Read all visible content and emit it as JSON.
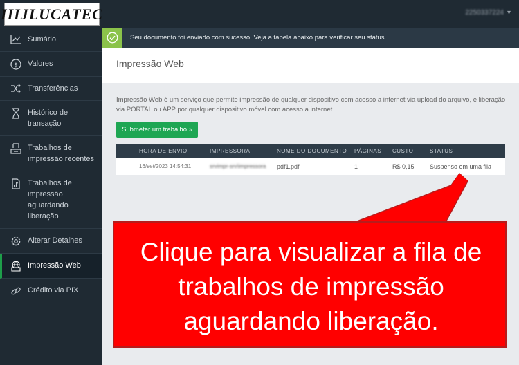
{
  "header": {
    "logo_text": "IIIJLUCATEC",
    "user": "2250337224"
  },
  "alert": {
    "message": "Seu documento foi enviado com sucesso. Veja a tabela abaixo para verificar seu status."
  },
  "sidebar": {
    "items": [
      {
        "label": "Sumário",
        "icon": "chart-line-icon"
      },
      {
        "label": "Valores",
        "icon": "dollar-icon"
      },
      {
        "label": "Transferências",
        "icon": "shuffle-icon"
      },
      {
        "label": "Histórico de transação",
        "icon": "hourglass-icon"
      },
      {
        "label": "Trabalhos de impressão recentes",
        "icon": "printer-tray-icon"
      },
      {
        "label": "Trabalhos de impressão aguardando liberação",
        "icon": "document-music-icon"
      },
      {
        "label": "Alterar Detalhes",
        "icon": "gear-icon"
      },
      {
        "label": "Impressão Web",
        "icon": "web-printer-icon",
        "active": true
      },
      {
        "label": "Crédito via PIX",
        "icon": "link-icon"
      }
    ]
  },
  "page": {
    "title": "Impressão Web",
    "description": "Impressão Web é um serviço que permite impressão de qualquer dispositivo com acesso a internet via upload do arquivo, e liberação via PORTAL ou APP por qualquer dispositivo móvel com acesso a internet.",
    "submit_label": "Submeter um trabalho »"
  },
  "table": {
    "headers": [
      "HORA DE ENVIO",
      "IMPRESSORA",
      "NOME DO DOCUMENTO",
      "PÁGINAS",
      "CUSTO",
      "STATUS"
    ],
    "rows": [
      {
        "time": "16/set/2023 14:54:31",
        "printer": "srvimpr-srv\\impressora",
        "document": "pdf1.pdf",
        "pages": "1",
        "cost": "R$ 0,15",
        "status": "Suspenso em uma fila"
      }
    ]
  },
  "callout": {
    "text": "Clique para visualizar a fila de trabalhos de impressão aguardando liberação."
  },
  "colors": {
    "sidebar_bg": "#1f2a33",
    "accent_green": "#1ea653",
    "alert_check": "#8bc34a",
    "callout_red": "#ff0000"
  }
}
